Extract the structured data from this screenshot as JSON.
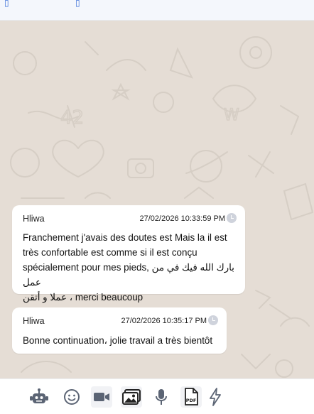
{
  "messages": [
    {
      "sender": "Hliwa",
      "time": "27/02/2026 10:33:59 PM",
      "line1": "Franchement j'avais des doutes est Mais la il est",
      "line2": "très confortable est comme si il est conçu",
      "line3_latin": "spécialement pour mes pieds,",
      "line3_arabic": "بارك الله فيك في من عمل",
      "line4_arabic": "عملا و أتقن",
      "line4_rest": "، merci beaucoup"
    },
    {
      "sender": "Hliwa",
      "time": "27/02/2026 10:35:17 PM",
      "text": "Bonne continuation، jolie travail a très bientôt"
    }
  ],
  "toolbar": {
    "icons": [
      "bot-icon",
      "emoji-icon",
      "video-icon",
      "image-icon",
      "microphone-icon",
      "pdf-icon",
      "lightning-icon"
    ],
    "pdf_label": "PDF"
  },
  "colors": {
    "chat_background": "#e5ddd5",
    "bubble": "#ffffff",
    "icon": "#5b6474"
  }
}
